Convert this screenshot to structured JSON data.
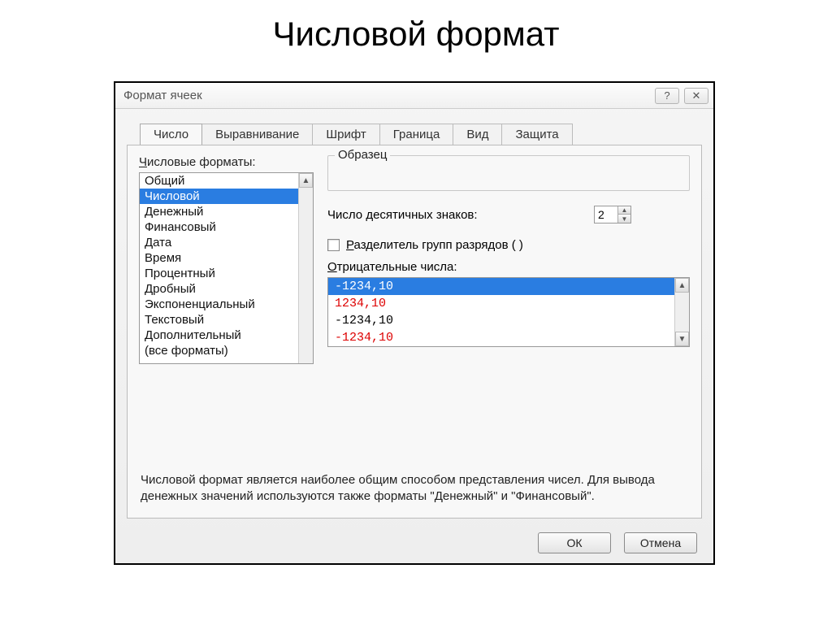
{
  "slide": {
    "title": "Числовой формат"
  },
  "dialog": {
    "title": "Формат ячеек",
    "tabs": [
      "Число",
      "Выравнивание",
      "Шрифт",
      "Граница",
      "Вид",
      "Защита"
    ],
    "active_tab": 0,
    "formats_label": "Числовые форматы:",
    "format_list": [
      "Общий",
      "Числовой",
      "Денежный",
      "Финансовый",
      "Дата",
      "Время",
      "Процентный",
      "Дробный",
      "Экспоненциальный",
      "Текстовый",
      "Дополнительный",
      "(все форматы)"
    ],
    "format_selected": 1,
    "sample_label": "Образец",
    "decimal_label": "Число десятичных знаков:",
    "decimal_value": "2",
    "separator_label": "Разделитель групп разрядов ( )",
    "negative_label": "Отрицательные числа:",
    "negative_items": [
      {
        "text": "-1234,10",
        "selected": true,
        "red": false
      },
      {
        "text": "1234,10",
        "selected": false,
        "red": true
      },
      {
        "text": "-1234,10",
        "selected": false,
        "red": false
      },
      {
        "text": "-1234,10",
        "selected": false,
        "red": true
      }
    ],
    "description": "Числовой формат является наиболее общим способом представления чисел. Для вывода денежных значений используются также форматы \"Денежный\" и \"Финансовый\".",
    "ok": "ОК",
    "cancel": "Отмена"
  }
}
